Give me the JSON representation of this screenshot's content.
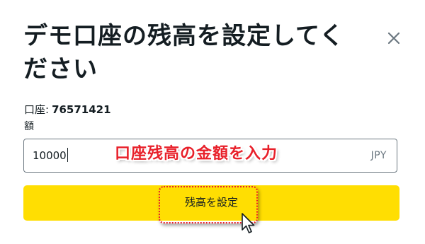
{
  "dialog": {
    "title": "デモ口座の残高を設定してください",
    "close_icon": "close-icon",
    "account_label": "口座:",
    "account_number": "76571421",
    "amount_label": "額",
    "amount_value": "10000",
    "currency": "JPY",
    "submit_label": "残高を設定"
  },
  "annotation": {
    "text": "口座残高の金額を入力",
    "color": "#e8202a"
  },
  "colors": {
    "button_background": "#ffde02",
    "text": "#141d22",
    "border": "#6b7780",
    "annotation_red": "#e8202a"
  },
  "cursor_icon": "mouse-pointer-icon"
}
